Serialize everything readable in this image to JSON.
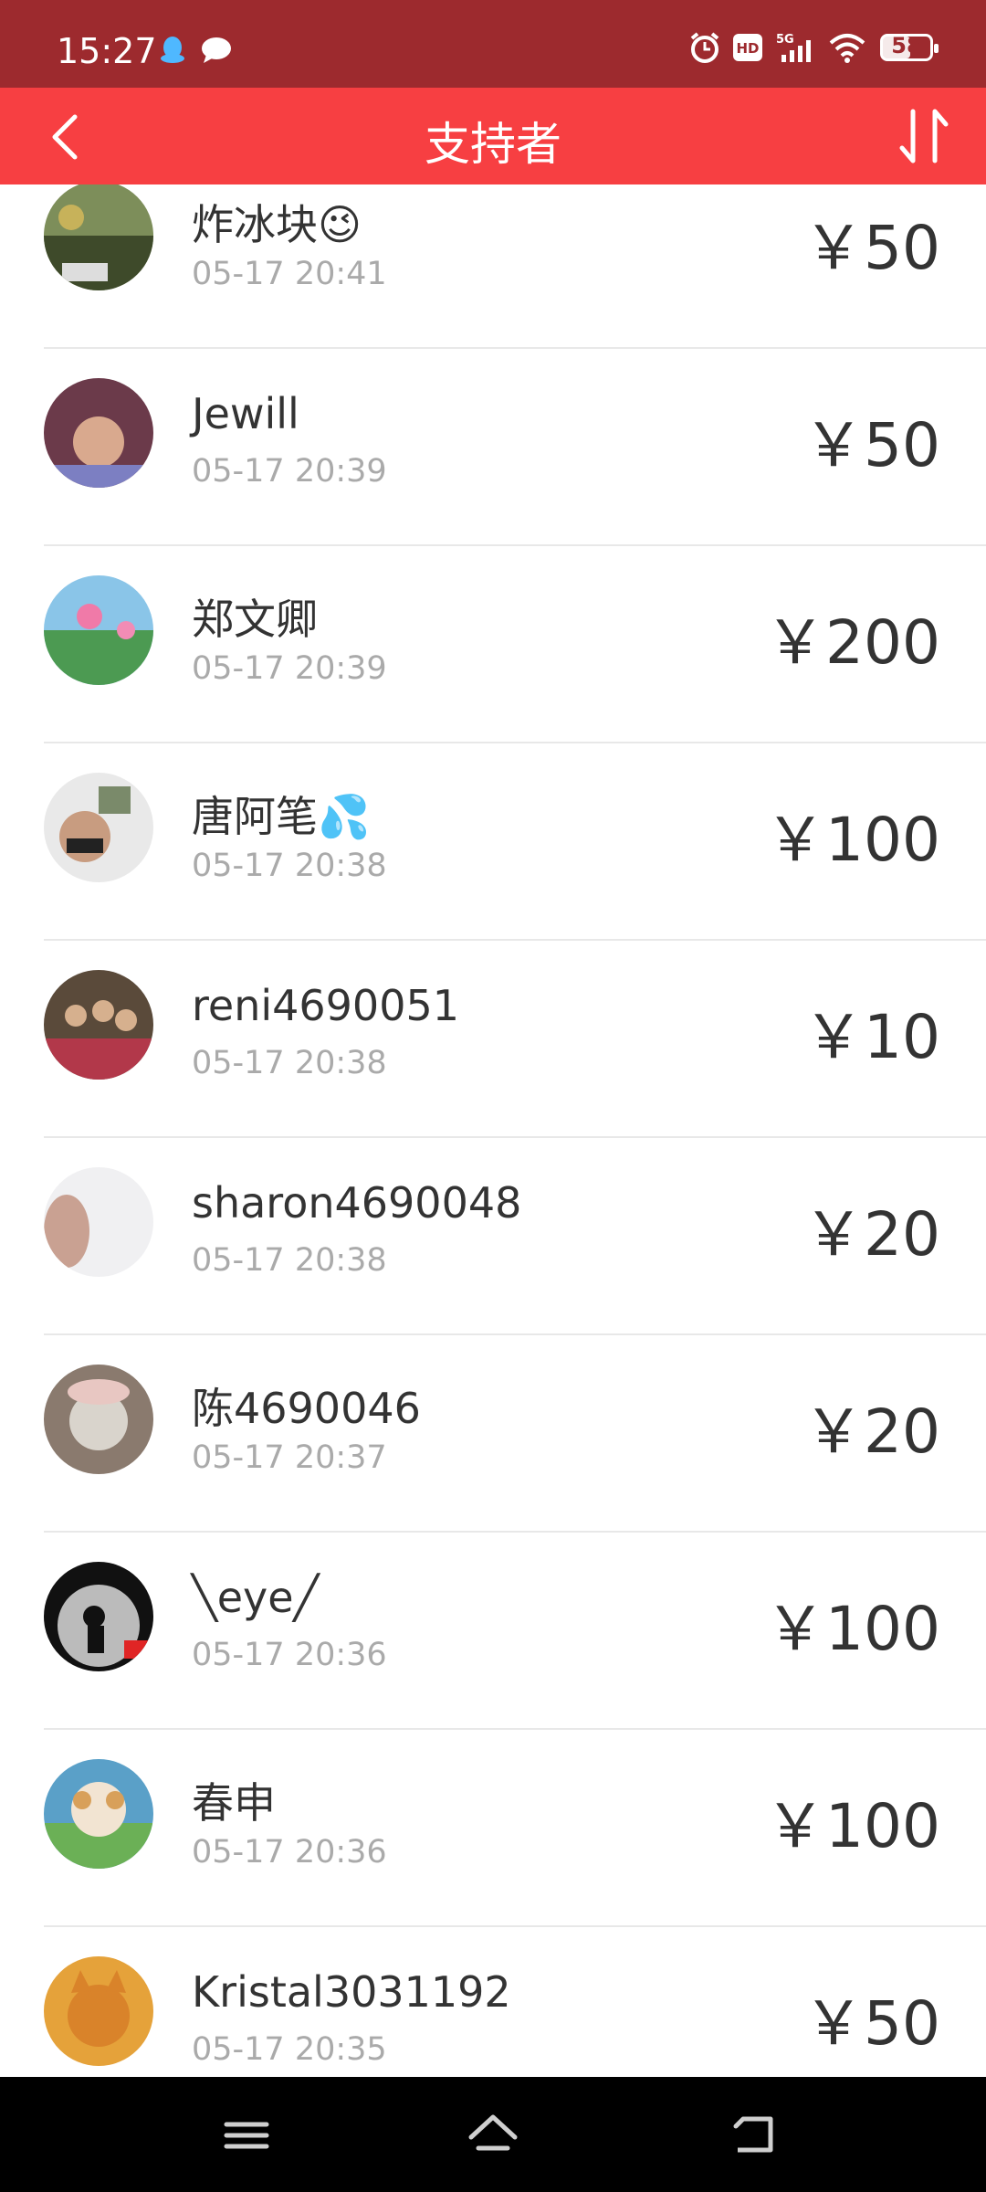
{
  "status": {
    "time": "15:27",
    "network": "5G",
    "battery": "58",
    "battery_level": 0.58
  },
  "header": {
    "title": "支持者"
  },
  "supporters": [
    {
      "name": "炸冰块😉",
      "time": "05-17 20:41",
      "amount": "￥50"
    },
    {
      "name": "Jewill",
      "time": "05-17 20:39",
      "amount": "￥50"
    },
    {
      "name": "郑文卿",
      "time": "05-17 20:39",
      "amount": "￥200"
    },
    {
      "name": "唐阿笔💦",
      "time": "05-17 20:38",
      "amount": "￥100"
    },
    {
      "name": "reni4690051",
      "time": "05-17 20:38",
      "amount": "￥10"
    },
    {
      "name": "sharon4690048",
      "time": "05-17 20:38",
      "amount": "￥20"
    },
    {
      "name": "陈4690046",
      "time": "05-17 20:37",
      "amount": "￥20"
    },
    {
      "name": "╲eye╱",
      "time": "05-17 20:36",
      "amount": "￥100"
    },
    {
      "name": "春申",
      "time": "05-17 20:36",
      "amount": "￥100"
    },
    {
      "name": "Kristal3031192",
      "time": "05-17 20:35",
      "amount": "￥50"
    }
  ],
  "colors": {
    "statusbar": "#9d2a2e",
    "header": "#f73f42",
    "text": "#333333",
    "subtext": "#aaaaaa"
  }
}
